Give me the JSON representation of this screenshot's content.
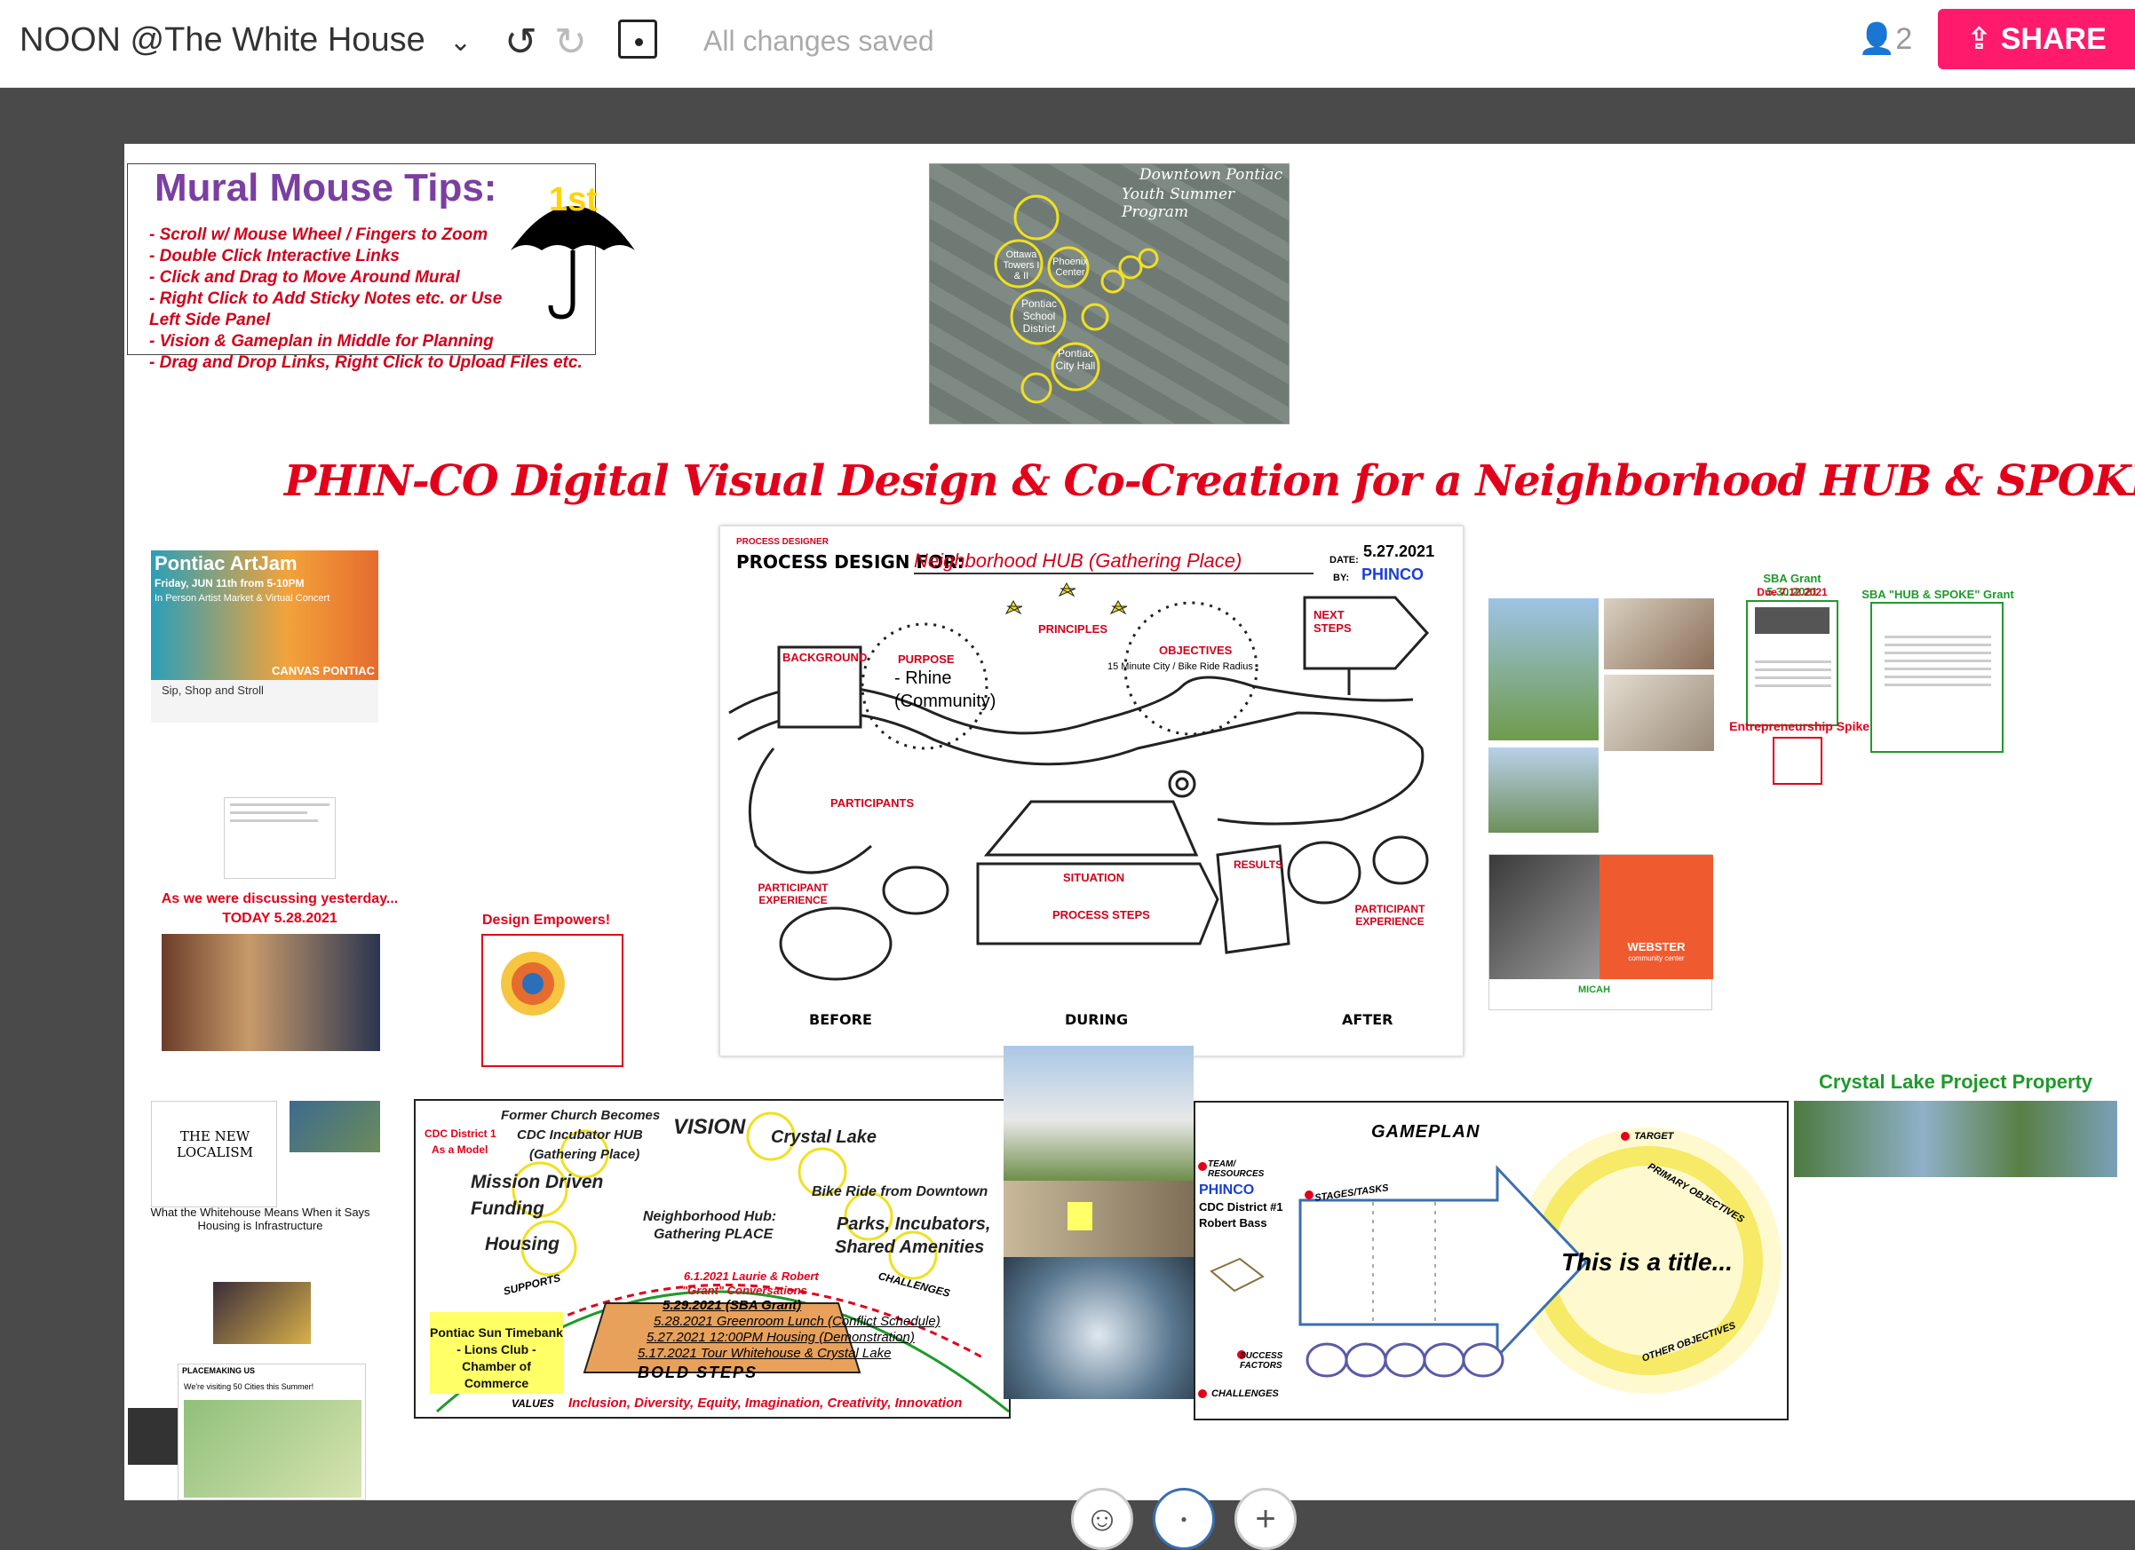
{
  "header": {
    "title": "NOON @The White House",
    "status": "All changes saved",
    "collaborators": "2",
    "share_label": "SHARE"
  },
  "tips": {
    "title": "Mural Mouse Tips:",
    "lines": [
      "- Scroll w/ Mouse Wheel / Fingers to Zoom",
      "- Double Click Interactive Links",
      "- Click and Drag to Move Around Mural",
      "- Right Click to Add Sticky Notes etc. or Use",
      "Left Side Panel",
      "- Vision & Gameplan in Middle for Planning",
      "- Drag and Drop Links, Right Click to Upload Files etc."
    ],
    "umbrella_text": "1st"
  },
  "map": {
    "title": "Downtown Pontiac",
    "subtitle": "Youth Summer Program",
    "labels": [
      "Ottawa Towers I & II",
      "Phoenix Center",
      "Pontiac School District",
      "Pontiac City Hall"
    ]
  },
  "banner": "PHIN-CO Digital Visual Design & Co-Creation for a Neighborhood HUB & SPOKE (Gathering Place)",
  "artjam": {
    "title": "Pontiac ArtJam",
    "date": "Friday, JUN 11th from 5-10PM",
    "sub": "In Person Artist Market & Virtual Concert",
    "footer": "Sip, Shop and Stroll",
    "brand": "CANVAS PONTIAC"
  },
  "captions": {
    "discussing": "As we were discussing yesterday...",
    "today": "TODAY 5.28.2021",
    "design_empowers": "Design Empowers!",
    "whitehouse": "What the Whitehouse Means When it Says Housing is Infrastructure",
    "localism": "THE NEW LOCALISM",
    "placemaking": "PLACEMAKING US",
    "placemaking_sub": "We're visiting 50 Cities this Summer!",
    "sba_grant": "SBA Grant 5.30.2021",
    "sba_due": "Due 7.12.2021",
    "sba_hub": "SBA \"HUB & SPOKE\" Grant PDF",
    "entre": "Entrepreneurship Spikes",
    "crystal": "Crystal Lake Project Property",
    "webster": "WEBSTER",
    "webster_sub": "community center",
    "micah": "MICAH"
  },
  "process": {
    "label": "PROCESS DESIGNER",
    "heading": "PROCESS DESIGN FOR:",
    "for": "Neighborhood HUB (Gathering Place)",
    "date_label": "DATE:",
    "date": "5.27.2021",
    "by_label": "BY:",
    "by": "PHINCO",
    "background": "BACKGROUND",
    "purpose": "PURPOSE",
    "purpose_val1": "- Rhine",
    "purpose_val2": "(Community)",
    "principles": "PRINCIPLES",
    "objectives": "OBJECTIVES",
    "objectives_val": "15 Minute City / Bike Ride Radius",
    "next": "NEXT STEPS",
    "participants": "PARTICIPANTS",
    "pexp": "PARTICIPANT EXPERIENCE",
    "situation": "SITUATION",
    "steps": "PROCESS STEPS",
    "results": "RESULTS",
    "before": "BEFORE",
    "during": "DURING",
    "after": "AFTER"
  },
  "vision": {
    "church": "Former Church Becomes",
    "incubator": "CDC Incubator HUB",
    "gathering": "(Gathering Place)",
    "title": "VISION",
    "crystal": "Crystal Lake",
    "cdc": "CDC District 1",
    "model": "As a Model",
    "mission": "Mission Driven",
    "funding": "Funding",
    "housing": "Housing",
    "bike": "Bike Ride from Downtown",
    "hub": "Neighborhood Hub:",
    "place": "Gathering PLACE",
    "parks": "Parks, Incubators,",
    "amenities": "Shared Amenities",
    "supports": "SUPPORTS",
    "challenges": "CHALLENGES",
    "s6a": "6.1.2021 Laurie & Robert",
    "s6b": "\"Grant\" Conversations",
    "s5": "5.29.2021 (SBA Grant)",
    "s4": "5.28.2021 Greenroom Lunch (Conflict Schedule)",
    "s3": "5.27.2021 12:00PM Housing (Demonstration)",
    "s2": "5.17.2021 Tour Whitehouse & Crystal Lake",
    "bold": "BOLD STEPS",
    "yellow": "Pontiac Sun Timebank - Lions Club - Chamber of Commerce",
    "values_label": "VALUES",
    "values": "Inclusion, Diversity, Equity, Imagination, Creativity, Innovation"
  },
  "gameplan": {
    "title": "GAMEPLAN",
    "team": "TEAM/ RESOURCES",
    "org": "PHINCO",
    "district": "CDC District #1",
    "person": "Robert Bass",
    "stages": "STAGES/TASKS",
    "target": "TARGET",
    "primary": "PRIMARY OBJECTIVES",
    "title_text": "This is a title...",
    "other": "OTHER OBJECTIVES",
    "success": "SUCCESS FACTORS",
    "challenges": "CHALLENGES"
  },
  "colors": {
    "accent": "#ff1a6c",
    "red": "#e2001a",
    "purple": "#7a3fa0",
    "green": "#1f9a2b",
    "blue": "#1a3fd6"
  }
}
